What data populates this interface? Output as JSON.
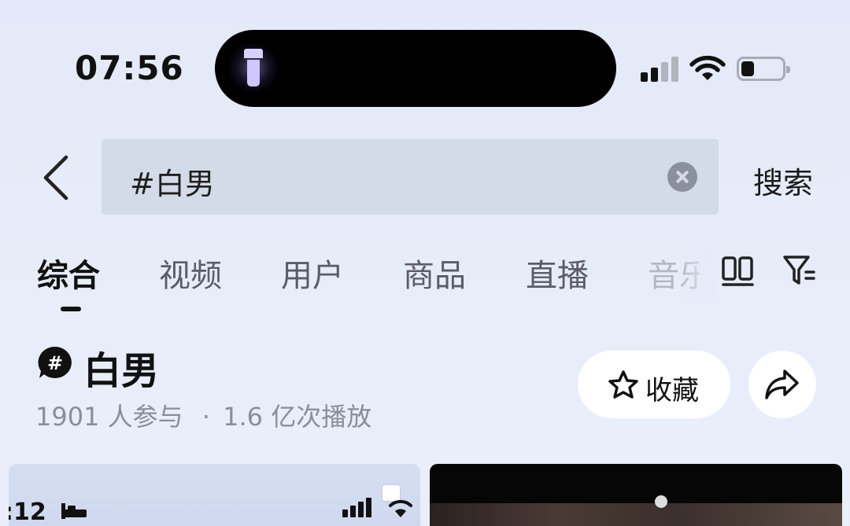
{
  "status_bar": {
    "time": "07:56",
    "battery_level": 0.2
  },
  "search": {
    "query": "#白男",
    "submit_label": "搜索"
  },
  "tabs": [
    {
      "label": "综合",
      "active": true
    },
    {
      "label": "视频",
      "active": false
    },
    {
      "label": "用户",
      "active": false
    },
    {
      "label": "商品",
      "active": false
    },
    {
      "label": "直播",
      "active": false
    },
    {
      "label": "音乐",
      "active": false
    }
  ],
  "topic": {
    "title": "白男",
    "participants": "1901 人参与",
    "separator": "·",
    "plays": "1.6 亿次播放",
    "favorite_label": "收藏"
  },
  "cards": [
    {
      "time_fragment": ":12"
    }
  ],
  "colors": {
    "background": "#e6ebf9",
    "search_field": "#d4dbe8",
    "text_primary": "#111111",
    "text_secondary": "#8a8e99"
  },
  "icons": [
    "flashlight-icon",
    "signal-icon",
    "wifi-icon",
    "battery-icon",
    "back-icon",
    "clear-icon",
    "grid-view-icon",
    "filter-icon",
    "hashtag-icon",
    "star-icon",
    "share-icon"
  ]
}
